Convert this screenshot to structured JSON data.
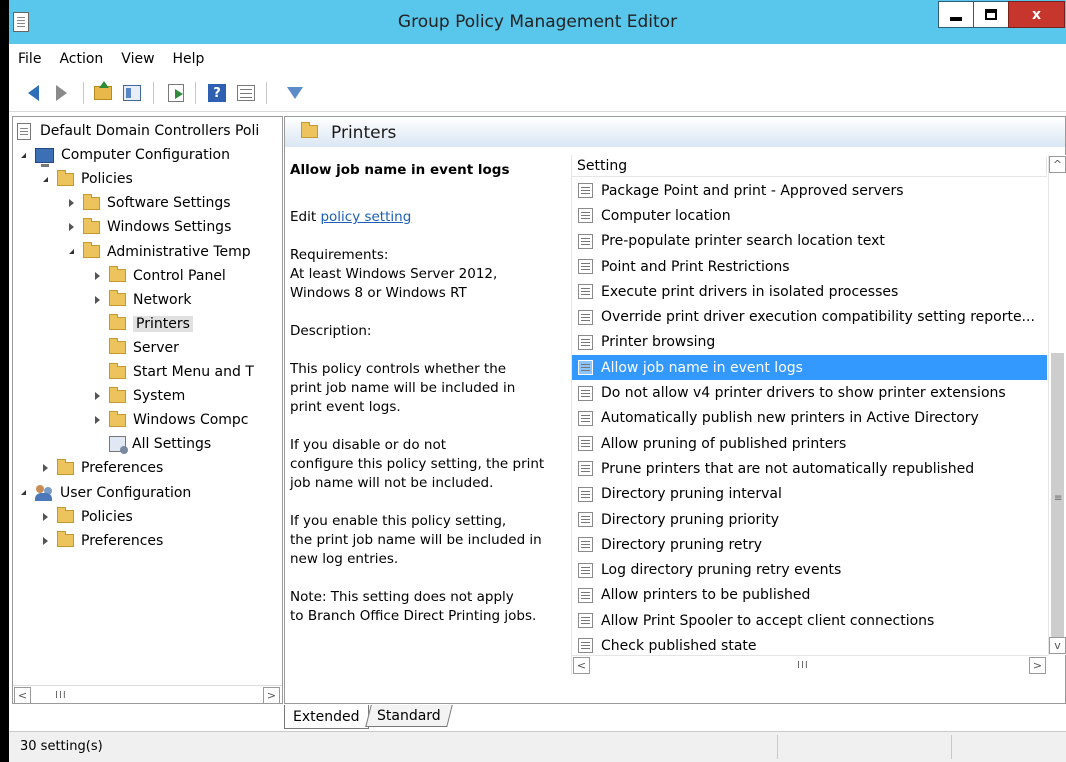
{
  "window": {
    "title": "Group Policy Management Editor",
    "close_glyph": "x"
  },
  "menu": [
    "File",
    "Action",
    "View",
    "Help"
  ],
  "toolbar": {
    "icons": [
      "back-arrow-icon",
      "forward-arrow-icon",
      "folder-up-icon",
      "show-hide-tree-icon",
      "export-list-icon",
      "help-icon",
      "properties-grid-icon",
      "filter-icon"
    ],
    "help_glyph": "?"
  },
  "tree": {
    "items": [
      {
        "label": "Default Domain Controllers Poli",
        "level": 0,
        "icon": "policy-document-icon",
        "expander": "none"
      },
      {
        "label": "Computer Configuration",
        "level": 0,
        "icon": "computer-icon",
        "expander": "expanded"
      },
      {
        "label": "Policies",
        "level": 1,
        "icon": "folder-icon",
        "expander": "expanded"
      },
      {
        "label": "Software Settings",
        "level": 2,
        "icon": "folder-icon",
        "expander": "collapsed"
      },
      {
        "label": "Windows Settings",
        "level": 2,
        "icon": "folder-icon",
        "expander": "collapsed"
      },
      {
        "label": "Administrative Temp",
        "level": 2,
        "icon": "folder-icon",
        "expander": "expanded"
      },
      {
        "label": "Control Panel",
        "level": 3,
        "icon": "folder-icon",
        "expander": "collapsed"
      },
      {
        "label": "Network",
        "level": 3,
        "icon": "folder-icon",
        "expander": "collapsed"
      },
      {
        "label": "Printers",
        "level": 3,
        "icon": "folder-icon",
        "expander": "none",
        "selected": true
      },
      {
        "label": "Server",
        "level": 3,
        "icon": "folder-icon",
        "expander": "none"
      },
      {
        "label": "Start Menu and T",
        "level": 3,
        "icon": "folder-icon",
        "expander": "none"
      },
      {
        "label": "System",
        "level": 3,
        "icon": "folder-icon",
        "expander": "collapsed"
      },
      {
        "label": "Windows Compc",
        "level": 3,
        "icon": "folder-icon",
        "expander": "collapsed"
      },
      {
        "label": "All Settings",
        "level": 3,
        "icon": "all-settings-icon",
        "expander": "none"
      },
      {
        "label": "Preferences",
        "level": 1,
        "icon": "folder-icon",
        "expander": "collapsed"
      },
      {
        "label": "User Configuration",
        "level": 0,
        "icon": "users-icon",
        "expander": "expanded"
      },
      {
        "label": "Policies",
        "level": 1,
        "icon": "folder-icon",
        "expander": "collapsed"
      },
      {
        "label": "Preferences",
        "level": 1,
        "icon": "folder-icon",
        "expander": "collapsed"
      }
    ]
  },
  "details": {
    "folder_title": "Printers",
    "selected_title": "Allow job name in event logs",
    "edit_prefix": "Edit ",
    "edit_link": "policy setting",
    "requirements": "Requirements:\nAt least Windows Server 2012,\nWindows 8 or Windows RT",
    "description_label": "Description:",
    "paragraphs": [
      "      This policy controls whether the\nprint job name will be included in\nprint event logs.",
      "      If you disable or do not\nconfigure this policy setting, the print\njob name will not be included.",
      "      If you enable this policy setting,\nthe print job name will be included in\nnew log entries.",
      "      Note: This setting does not apply\nto Branch Office Direct Printing jobs."
    ]
  },
  "settings_list": {
    "column_header": "Setting",
    "rows": [
      "Package Point and print - Approved servers",
      "Computer location",
      "Pre-populate printer search location text",
      "Point and Print Restrictions",
      "Execute print drivers in isolated processes",
      "Override print driver execution compatibility setting reporte...",
      "Printer browsing",
      "Allow job name in event logs",
      "Do not allow v4 printer drivers to show printer extensions",
      "Automatically publish new printers in Active Directory",
      "Allow pruning of published printers",
      "Prune printers that are not automatically republished",
      "Directory pruning interval",
      "Directory pruning priority",
      "Directory pruning retry",
      "Log directory pruning retry events",
      "Allow printers to be published",
      "Allow Print Spooler to accept client connections",
      "Check published state"
    ],
    "selected_index": 7
  },
  "scroll": {
    "up": "^",
    "down": "v",
    "left": "<",
    "right": ">",
    "grip_vertical": "≡",
    "grip_horizontal": "III"
  },
  "tabs": [
    "Extended",
    "Standard"
  ],
  "status": {
    "text": "30 setting(s)"
  }
}
